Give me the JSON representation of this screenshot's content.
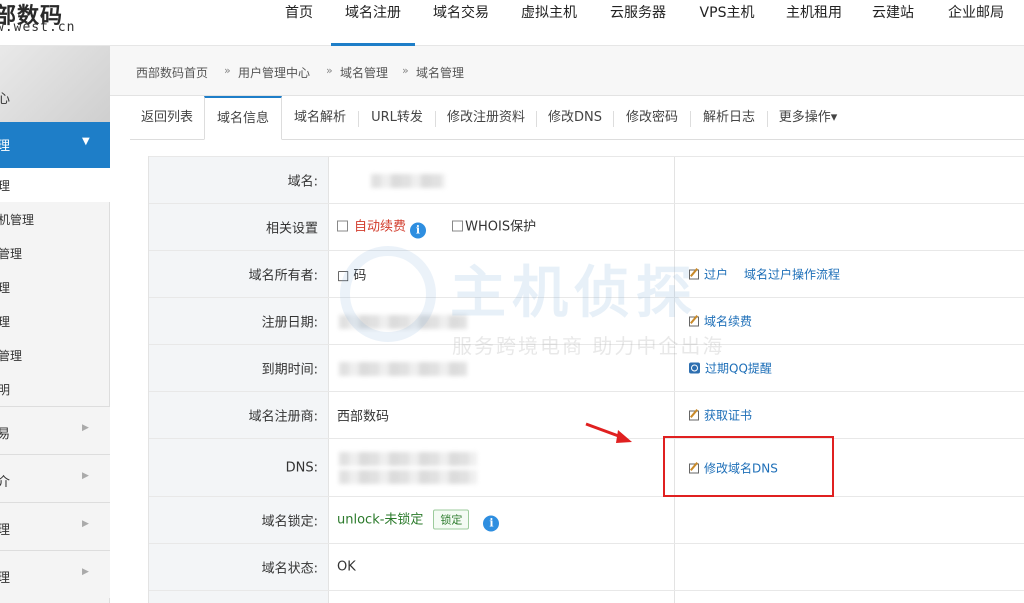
{
  "header": {
    "logo_main": "部数码",
    "logo_sub": "w.west.cn",
    "nav": [
      "首页",
      "域名注册",
      "域名交易",
      "虚拟主机",
      "云服务器",
      "VPS主机",
      "主机租用",
      "云建站",
      "企业邮局"
    ],
    "active_nav": "域名注册"
  },
  "sidebar": {
    "top_label": "心",
    "active_label": "理",
    "sub_items": [
      "理",
      "机管理",
      "管理",
      "理",
      "理",
      "管理",
      "明"
    ],
    "groups": [
      "易",
      "介",
      "理",
      "理"
    ]
  },
  "breadcrumb": [
    "西部数码首页",
    "用户管理中心",
    "域名管理",
    "域名管理"
  ],
  "tabs": [
    "返回列表",
    "域名信息",
    "域名解析",
    "URL转发",
    "修改注册资料",
    "修改DNS",
    "修改密码",
    "解析日志",
    "更多操作▾"
  ],
  "active_tab": "域名信息",
  "rows": {
    "domain": {
      "label": "域名:"
    },
    "settings": {
      "label": "相关设置",
      "auto_renew": "自动续费",
      "whois": "WHOIS保护"
    },
    "owner": {
      "label": "域名所有者:",
      "value_partial": "□ 码",
      "transfer": "过户",
      "transfer_flow": "域名过户操作流程"
    },
    "reg_date": {
      "label": "注册日期:",
      "renew": "域名续费"
    },
    "exp_date": {
      "label": "到期时间:",
      "qq_remind": "过期QQ提醒"
    },
    "registrar": {
      "label": "域名注册商:",
      "value": "西部数码",
      "cert": "获取证书"
    },
    "dns": {
      "label": "DNS:",
      "modify_dns": "修改域名DNS"
    },
    "lock": {
      "label": "域名锁定:",
      "value": "unlock-未锁定",
      "lock_button": "锁定"
    },
    "status": {
      "label": "域名状态:",
      "value": "OK"
    }
  },
  "watermark": {
    "main": "主机侦探",
    "sub": "服务跨境电商 助力中企出海"
  },
  "colors": {
    "accent": "#1e7ec8",
    "highlight": "#e02020",
    "link": "#1e6fb8",
    "green": "#2b7a2b",
    "red_text": "#d23c2c"
  }
}
